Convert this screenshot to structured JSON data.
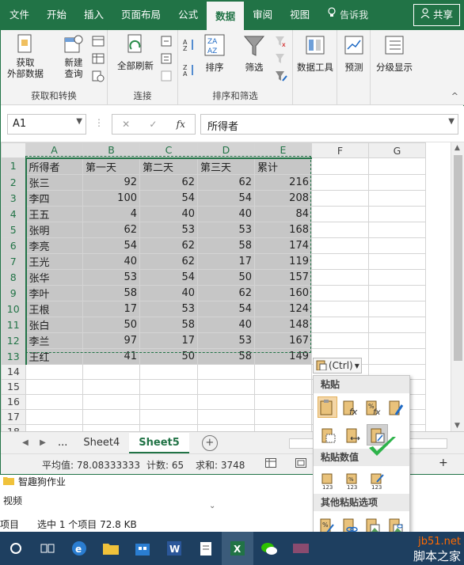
{
  "ribbon_tabs": [
    "文件",
    "开始",
    "插入",
    "页面布局",
    "公式",
    "数据",
    "审阅",
    "视图"
  ],
  "active_tab": "数据",
  "tell_me": "告诉我",
  "share": "共享",
  "ribbon": {
    "get_external": [
      "获取",
      "外部数据"
    ],
    "new_query": [
      "新建",
      "查询"
    ],
    "group1_label": "获取和转换",
    "refresh_all": "全部刷新",
    "group2_label": "连接",
    "sort": "排序",
    "filter": "筛选",
    "group3_label": "排序和筛选",
    "data_tools": "数据工具",
    "forecast": "预测",
    "outline": "分级显示"
  },
  "formula_bar": {
    "name_box": "A1",
    "formula": "所得者",
    "fx": "fx"
  },
  "columns": [
    "A",
    "B",
    "C",
    "D",
    "E",
    "F",
    "G"
  ],
  "table": {
    "header": [
      "所得者",
      "第一天",
      "第二天",
      "第三天",
      "累计"
    ],
    "rows": [
      [
        "张三",
        "92",
        "62",
        "62",
        "216"
      ],
      [
        "李四",
        "100",
        "54",
        "54",
        "208"
      ],
      [
        "王五",
        "4",
        "40",
        "40",
        "84"
      ],
      [
        "张明",
        "62",
        "53",
        "53",
        "168"
      ],
      [
        "李亮",
        "54",
        "62",
        "58",
        "174"
      ],
      [
        "王光",
        "40",
        "62",
        "17",
        "119"
      ],
      [
        "张华",
        "53",
        "54",
        "50",
        "157"
      ],
      [
        "李叶",
        "58",
        "40",
        "62",
        "160"
      ],
      [
        "王根",
        "17",
        "53",
        "54",
        "124"
      ],
      [
        "张白",
        "50",
        "58",
        "40",
        "148"
      ],
      [
        "李兰",
        "97",
        "17",
        "53",
        "167"
      ],
      [
        "王红",
        "41",
        "50",
        "58",
        "149"
      ]
    ],
    "extra_rows": [
      "14",
      "15",
      "16",
      "17",
      "18"
    ]
  },
  "sheets": {
    "ellipsis": "...",
    "tabs": [
      "Sheet4",
      "Sheet5"
    ],
    "active": "Sheet5"
  },
  "status": {
    "average": "平均值: 78.08333333",
    "count": "计数: 65",
    "sum": "求和: 3748"
  },
  "paste_button": "(Ctrl)",
  "paste_menu": {
    "paste": "粘贴",
    "paste_values": "粘贴数值",
    "other": "其他粘贴选项"
  },
  "explorer": {
    "folder": "智趣狗作业",
    "video": "视频",
    "status_items": "项目",
    "status_selected": "选中 1 个项目  72.8 KB"
  },
  "watermark": {
    "site": "jb51.net",
    "name": "脚本之家"
  },
  "colors": {
    "excel_green": "#217346",
    "taskbar": "#1e3f60",
    "selection": "#c6c6c6"
  }
}
